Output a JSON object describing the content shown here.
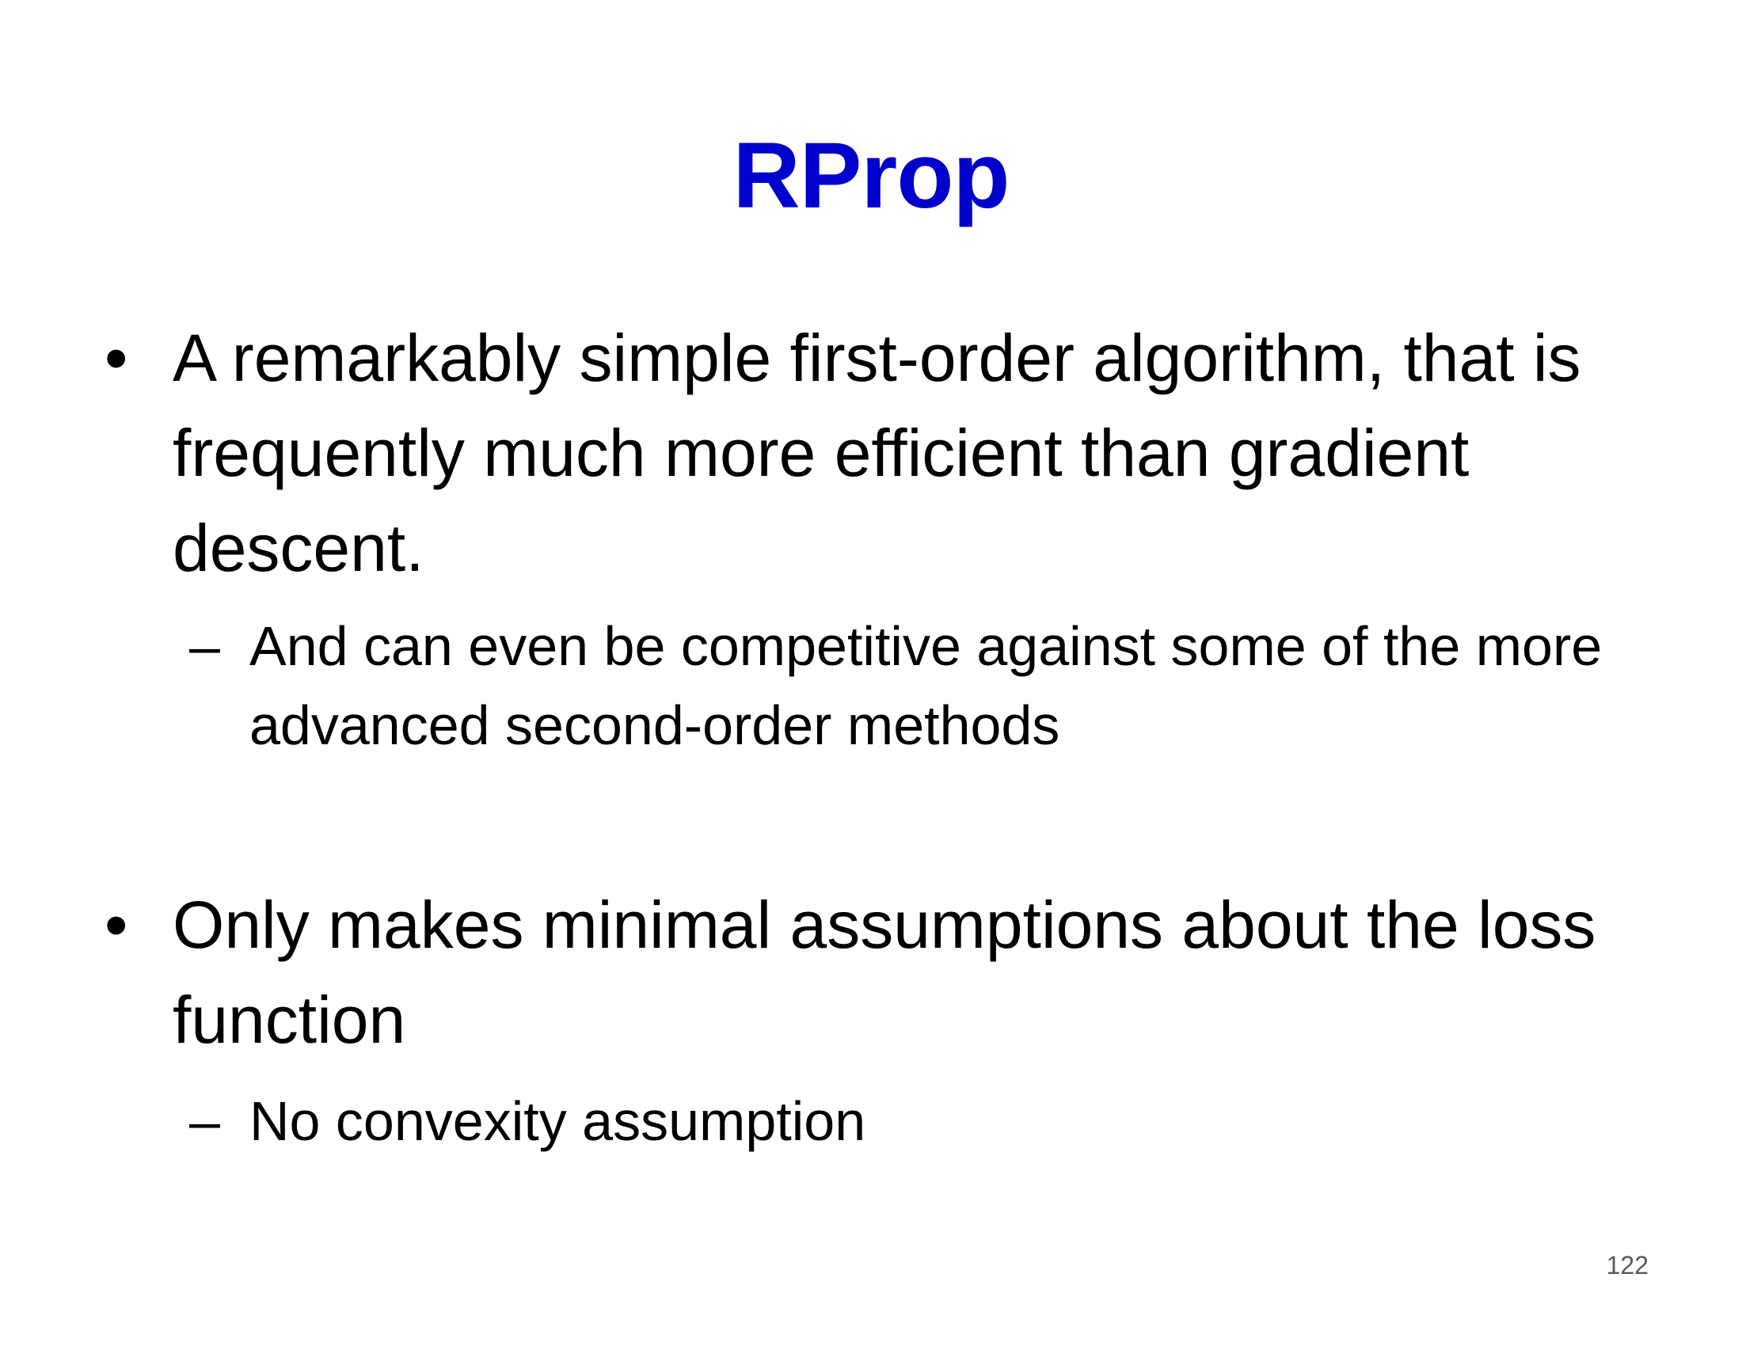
{
  "slide": {
    "title": "RProp",
    "title_color": "#0000cc",
    "bullets": [
      {
        "marker": "•",
        "text": "A remarkably simple first-order algorithm, that is frequently much more efficient than gradient descent.",
        "sub": {
          "marker": "–",
          "text": "And can even be competitive against some of the more advanced second-order methods"
        }
      },
      {
        "marker": "•",
        "text": "Only makes minimal assumptions about the loss function",
        "sub": {
          "marker": "–",
          "text": "No convexity assumption"
        }
      }
    ],
    "page_number": "122"
  }
}
